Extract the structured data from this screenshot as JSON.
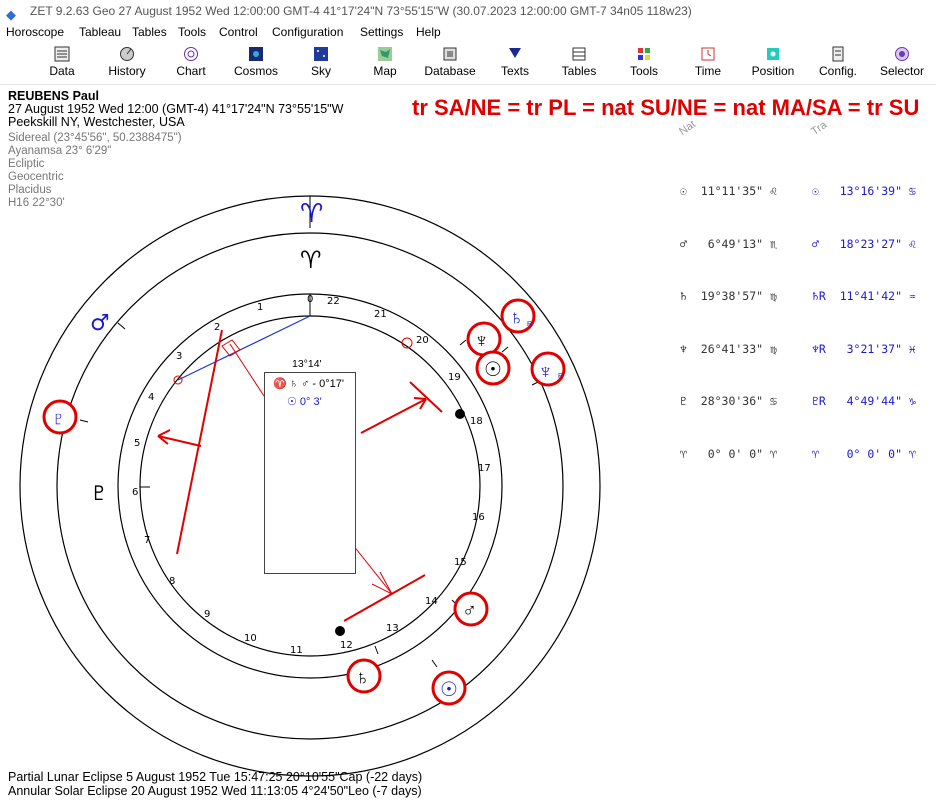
{
  "window": {
    "title": "ZET 9.2.63 Geo   27 August 1952   Wed   12:00:00 GMT-4 41°17'24\"N  73°55'15\"W   (30.07.2023  12:00:00 GMT-7 34n05 118w23)"
  },
  "menu": [
    "Horoscope",
    "Tableau",
    "Tables",
    "Tools",
    "Control",
    "Configuration",
    "Settings",
    "Help"
  ],
  "toolbar": [
    {
      "label": "Data",
      "icon": "data-icon"
    },
    {
      "label": "History",
      "icon": "history-icon"
    },
    {
      "label": "Chart",
      "icon": "chart-icon"
    },
    {
      "label": "Cosmos",
      "icon": "cosmos-icon"
    },
    {
      "label": "Sky",
      "icon": "sky-icon"
    },
    {
      "label": "Map",
      "icon": "map-icon"
    },
    {
      "label": "Database",
      "icon": "database-icon"
    },
    {
      "label": "Texts",
      "icon": "texts-icon"
    },
    {
      "label": "Tables",
      "icon": "tables-icon"
    },
    {
      "label": "Tools",
      "icon": "tools-icon"
    },
    {
      "label": "Time",
      "icon": "time-icon"
    },
    {
      "label": "Position",
      "icon": "position-icon"
    },
    {
      "label": "Config.",
      "icon": "config-icon"
    },
    {
      "label": "Selector",
      "icon": "selector-icon"
    }
  ],
  "chart_info": {
    "name": "REUBENS Paul",
    "datetime": "27 August 1952  Wed  12:00 (GMT-4) 41°17'24\"N  73°55'15\"W",
    "place": "Peekskill NY, Westchester, USA",
    "settings": [
      "Sidereal (23°45'56\", 50.2388475\")",
      "Ayanamsa 23° 6'29\"",
      "Ecliptic",
      "Geocentric",
      "Placidus",
      "H16  22°30'"
    ]
  },
  "headline": "tr SA/NE = tr PL = nat SU/NE = nat MA/SA = tr SU",
  "positions": {
    "natal_title": "Nat",
    "transit_title": "Tra",
    "natal": [
      "☉  11°11'35\" ♌",
      "♂   6°49'13\" ♏",
      "♄  19°38'57\" ♍",
      "♆  26°41'33\" ♍",
      "♇  28°30'36\" ♋",
      "♈   0° 0' 0\" ♈"
    ],
    "transit": [
      "☉   13°16'39\" ♋",
      "♂   18°23'27\" ♌",
      "♄R  11°41'42\" ♒",
      "♆R   3°21'37\" ♓",
      "♇R   4°49'44\" ♑",
      "♈    0° 0' 0\" ♈"
    ]
  },
  "wheel": {
    "center_box": {
      "title": "13°14'",
      "line1": "♈ ♄ ♂ - 0°17'",
      "line2": "☉   0° 3'"
    },
    "house_numbers": [
      "0",
      "1",
      "2",
      "3",
      "4",
      "5",
      "6",
      "7",
      "8",
      "9",
      "10",
      "11",
      "12",
      "13",
      "14",
      "15",
      "16",
      "17",
      "18",
      "19",
      "20",
      "21",
      "22"
    ],
    "glyphs": {
      "aries_outer": "♈",
      "aries_inner": "♈",
      "transit_mars": "♂",
      "transit_pluto": "♇",
      "natal_pluto": "♇",
      "natal_neptune": "♆",
      "natal_sun": "☉",
      "natal_mars": "♂",
      "natal_saturn": "♄",
      "transit_saturn": "♄",
      "transit_neptune": "♆",
      "transit_sun": "☉",
      "retro": "R"
    }
  },
  "colors": {
    "natal": "#000000",
    "transit": "#1a1ad0",
    "highlight": "#e00000"
  },
  "footer": [
    "Partial Lunar Eclipse 5 August 1952 Tue 15:47:25 20°10'55\"Cap (-22 days)",
    "Annular Solar Eclipse 20 August 1952 Wed 11:13:05  4°24'50\"Leo (-7 days)"
  ]
}
